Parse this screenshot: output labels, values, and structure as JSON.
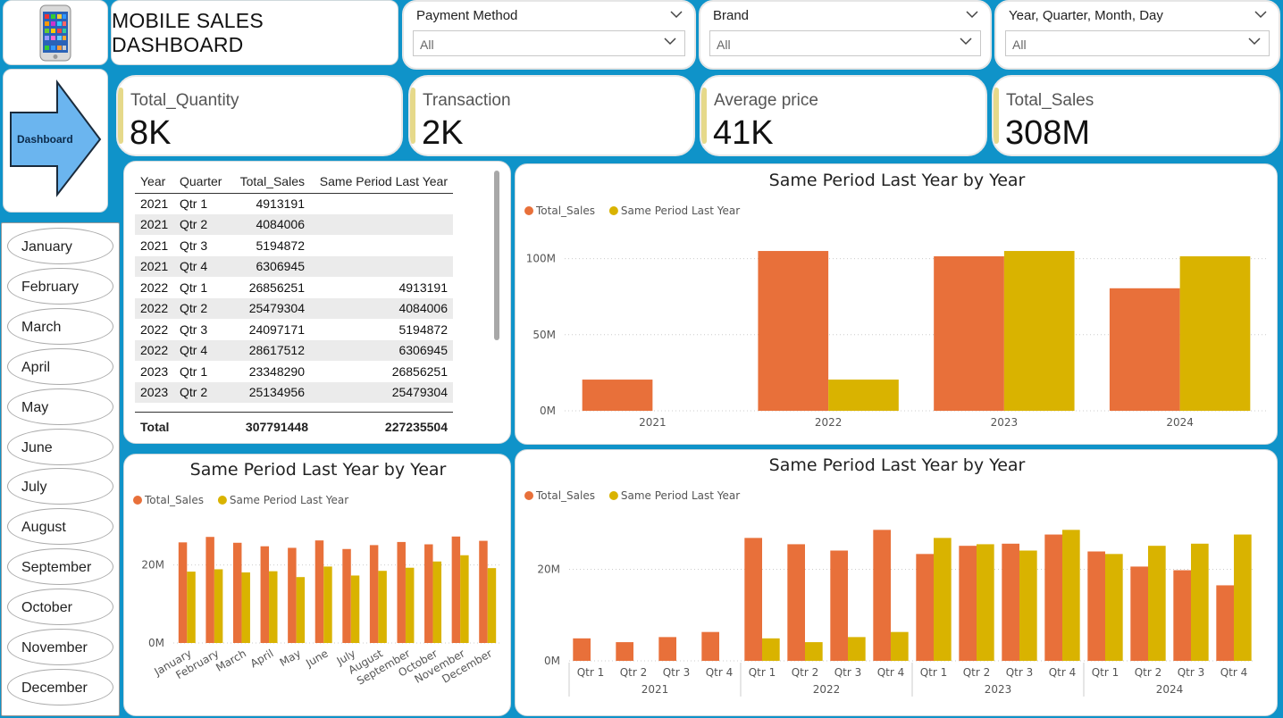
{
  "header": {
    "title": "MOBILE SALES DASHBOARD",
    "logo_icon": "smartphone-icon",
    "nav_label": "Dashboard"
  },
  "slicers": [
    {
      "label": "Payment Method",
      "value": "All"
    },
    {
      "label": "Brand",
      "value": "All"
    },
    {
      "label": "Year, Quarter, Month, Day",
      "value": "All"
    }
  ],
  "kpis": [
    {
      "label": "Total_Quantity",
      "value": "8K"
    },
    {
      "label": "Transaction",
      "value": "2K"
    },
    {
      "label": "Average price",
      "value": "41K"
    },
    {
      "label": "Total_Sales",
      "value": "308M"
    }
  ],
  "months": [
    "January",
    "February",
    "March",
    "April",
    "May",
    "June",
    "July",
    "August",
    "September",
    "October",
    "November",
    "December"
  ],
  "table": {
    "headers": [
      "Year",
      "Quarter",
      "Total_Sales",
      "Same Period Last Year"
    ],
    "rows": [
      [
        "2021",
        "Qtr 1",
        "4913191",
        ""
      ],
      [
        "2021",
        "Qtr 2",
        "4084006",
        ""
      ],
      [
        "2021",
        "Qtr 3",
        "5194872",
        ""
      ],
      [
        "2021",
        "Qtr 4",
        "6306945",
        ""
      ],
      [
        "2022",
        "Qtr 1",
        "26856251",
        "4913191"
      ],
      [
        "2022",
        "Qtr 2",
        "25479304",
        "4084006"
      ],
      [
        "2022",
        "Qtr 3",
        "24097171",
        "5194872"
      ],
      [
        "2022",
        "Qtr 4",
        "28617512",
        "6306945"
      ],
      [
        "2023",
        "Qtr 1",
        "23348290",
        "26856251"
      ],
      [
        "2023",
        "Qtr 2",
        "25134956",
        "25479304"
      ]
    ],
    "total_label": "Total",
    "total_sales": "307791448",
    "total_splv": "227235504"
  },
  "colors": {
    "total_sales": "#e8703a",
    "splv": "#d9b300"
  },
  "chart_data": [
    {
      "type": "bar",
      "title": "Same Period Last Year by Year",
      "categories": [
        "2021",
        "2022",
        "2023",
        "2024"
      ],
      "series": [
        {
          "name": "Total_Sales",
          "values": [
            20500000,
            105000000,
            101500000,
            80500000
          ]
        },
        {
          "name": "Same Period Last Year",
          "values": [
            0,
            20500000,
            105000000,
            101500000
          ]
        }
      ],
      "yticks": [
        "0M",
        "50M",
        "100M"
      ],
      "ylim": [
        0,
        115000000
      ],
      "legend": "top-left",
      "grid": true
    },
    {
      "type": "bar",
      "title": "Same Period Last Year by Year",
      "categories": [
        "January",
        "February",
        "March",
        "April",
        "May",
        "June",
        "July",
        "August",
        "September",
        "October",
        "November",
        "December"
      ],
      "series": [
        {
          "name": "Total_Sales",
          "values": [
            25800000,
            27200000,
            25700000,
            24800000,
            24400000,
            26300000,
            24100000,
            25100000,
            25900000,
            25300000,
            27300000,
            26200000
          ]
        },
        {
          "name": "Same Period Last Year",
          "values": [
            18300000,
            18900000,
            18100000,
            18400000,
            16900000,
            19600000,
            17300000,
            18500000,
            19300000,
            20900000,
            22500000,
            19200000
          ]
        }
      ],
      "yticks": [
        "0M",
        "20M"
      ],
      "ylim": [
        0,
        30000000
      ],
      "legend": "top-left",
      "grid": true
    },
    {
      "type": "bar",
      "title": "Same Period Last Year by Year",
      "categories": [
        "Qtr 1",
        "Qtr 2",
        "Qtr 3",
        "Qtr 4",
        "Qtr 1",
        "Qtr 2",
        "Qtr 3",
        "Qtr 4",
        "Qtr 1",
        "Qtr 2",
        "Qtr 3",
        "Qtr 4",
        "Qtr 1",
        "Qtr 2",
        "Qtr 3",
        "Qtr 4"
      ],
      "groups": [
        "2021",
        "2022",
        "2023",
        "2024"
      ],
      "series": [
        {
          "name": "Total_Sales",
          "values": [
            4913191,
            4084006,
            5194872,
            6306945,
            26856251,
            25479304,
            24097171,
            28617512,
            23348290,
            25134956,
            25600000,
            27600000,
            23900000,
            20600000,
            19800000,
            16500000
          ]
        },
        {
          "name": "Same Period Last Year",
          "values": [
            0,
            0,
            0,
            0,
            4913191,
            4084006,
            5194872,
            6306945,
            26856251,
            25479304,
            24097171,
            28617512,
            23348290,
            25134956,
            25600000,
            27600000
          ]
        }
      ],
      "yticks": [
        "0M",
        "20M"
      ],
      "ylim": [
        0,
        32000000
      ],
      "legend": "top-left",
      "grid": true
    }
  ]
}
